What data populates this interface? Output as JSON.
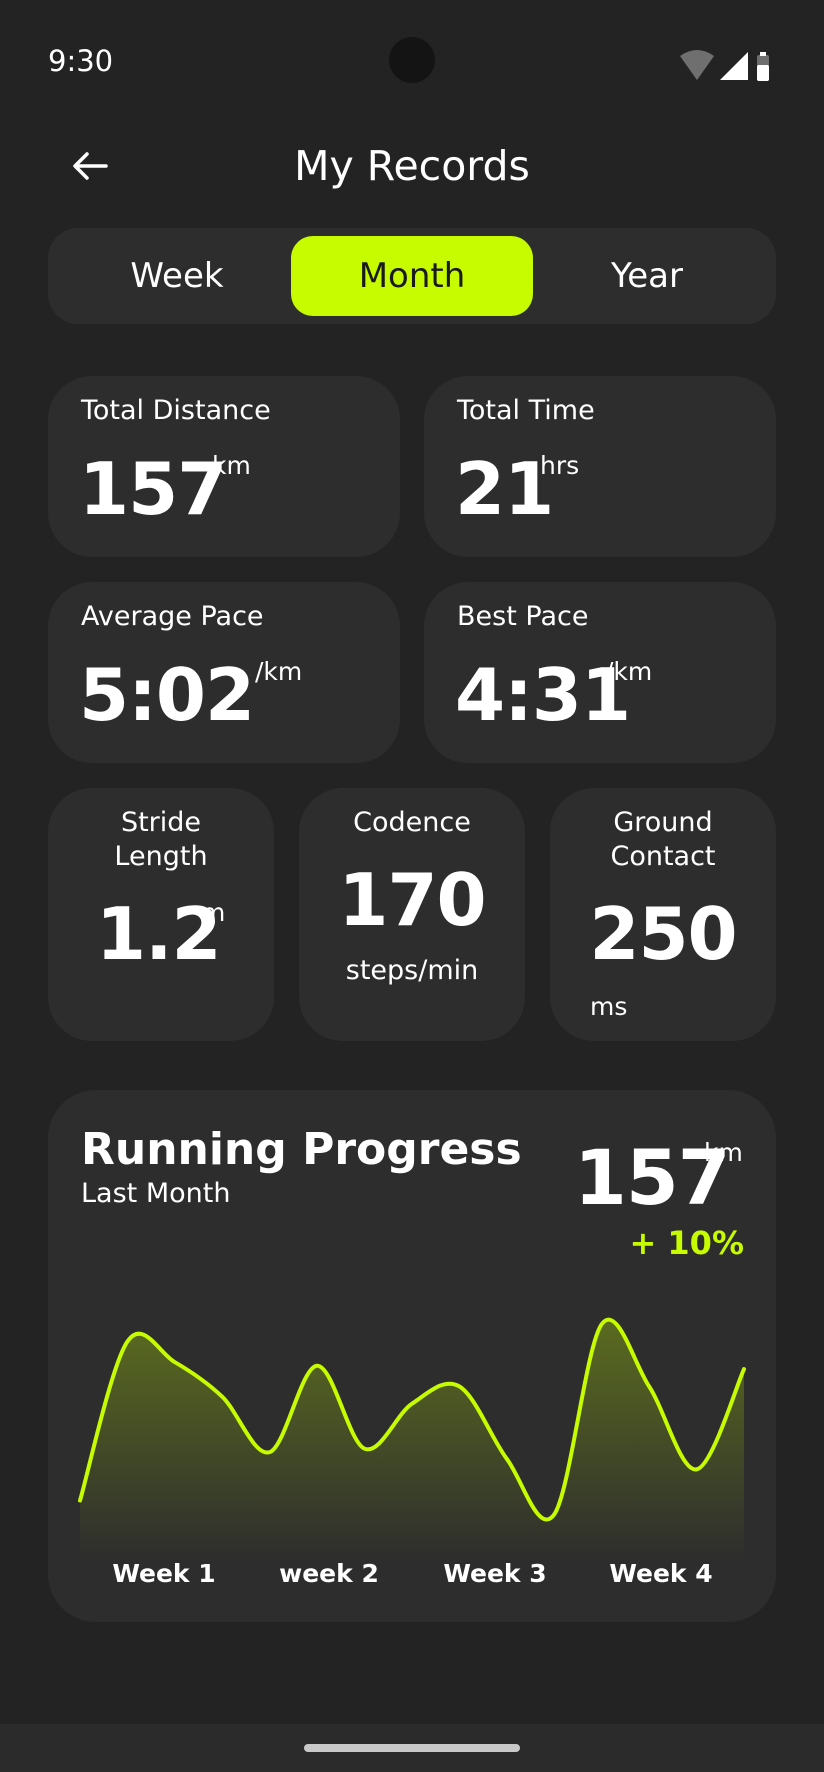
{
  "status_bar": {
    "time": "9:30"
  },
  "header": {
    "title": "My Records",
    "back_icon": "arrow-left-icon"
  },
  "tabs": {
    "items": [
      "Week",
      "Month",
      "Year"
    ],
    "selected": "Month",
    "accent_color": "#c6fb00"
  },
  "stats": {
    "total_distance": {
      "label": "Total Distance",
      "value": "157",
      "unit": "km"
    },
    "total_time": {
      "label": "Total Time",
      "value": "21",
      "unit": "hrs"
    },
    "average_pace": {
      "label": "Average Pace",
      "value": "5:02",
      "unit": "/km"
    },
    "best_pace": {
      "label": "Best Pace",
      "value": "4:31",
      "unit": "/km"
    },
    "stride_length": {
      "label_line1": "Stride",
      "label_line2": "Length",
      "value": "1.2",
      "unit": "m"
    },
    "cadence": {
      "label": "Codence",
      "value": "170",
      "unit": "steps/min"
    },
    "ground_contact": {
      "label_line1": "Ground",
      "label_line2": "Contact",
      "value": "250",
      "unit": "ms"
    }
  },
  "progress": {
    "title": "Running Progress",
    "subtitle": "Last Month",
    "value": "157",
    "unit": "km",
    "change": "+ 10%"
  },
  "chart_data": {
    "type": "area",
    "categories": [
      "Week 1",
      "week 2",
      "Week 3",
      "Week 4"
    ],
    "series": [
      {
        "values": [
          12,
          58,
          52,
          42,
          26,
          51,
          27,
          40,
          45,
          24,
          8,
          63,
          45,
          21,
          50
        ]
      }
    ],
    "ylim": [
      0,
      70
    ],
    "grid": false,
    "line_color": "#c6fb00"
  }
}
